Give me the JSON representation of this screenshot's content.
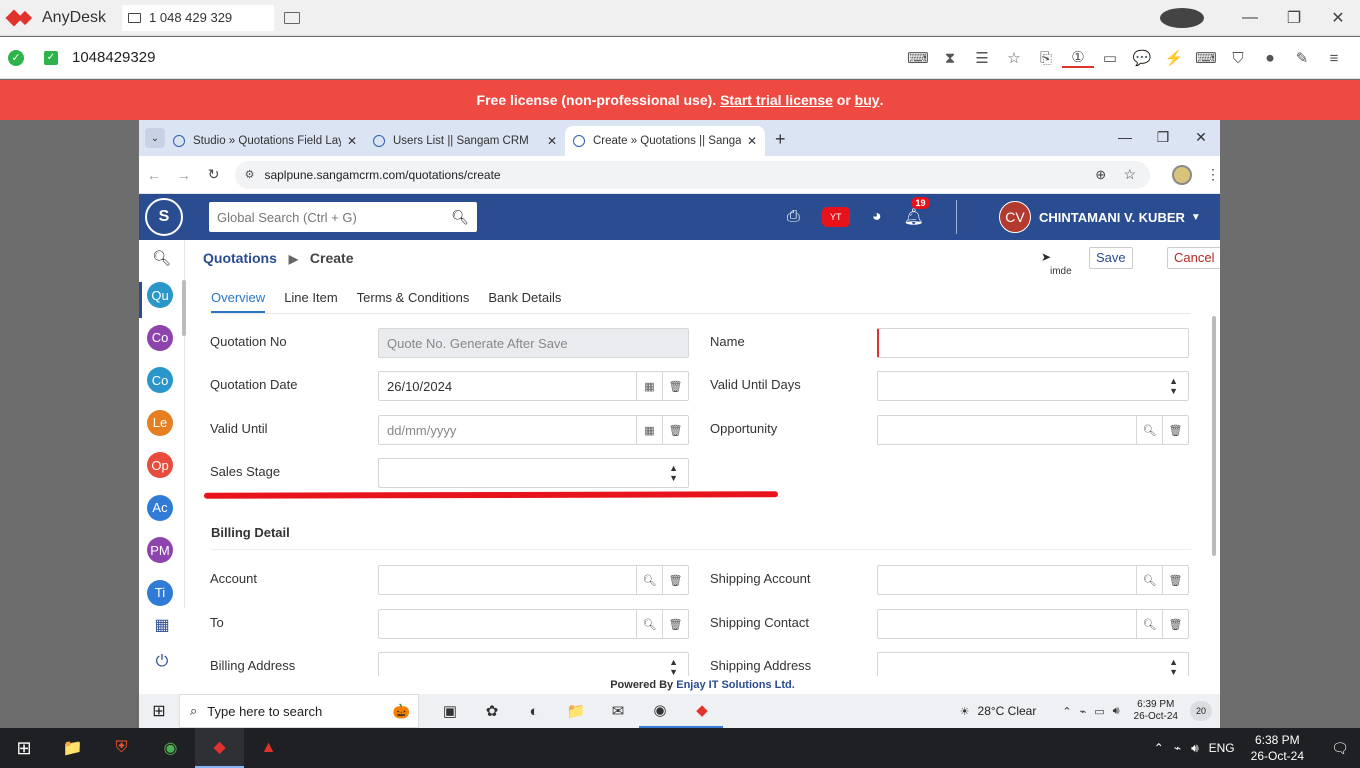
{
  "anydesk": {
    "app_name": "AnyDesk",
    "tab_label": "1 048 429 329",
    "address_id": "1048429329",
    "banner": {
      "text_pre": "Free license (non-professional use).",
      "trial_link": "Start trial license",
      "or": "or",
      "buy_link": "buy",
      "period": "."
    }
  },
  "browser": {
    "tabs": [
      {
        "title": "Studio » Quotations Field Layou"
      },
      {
        "title": "Users List || Sangam CRM"
      },
      {
        "title": "Create » Quotations || Sangam"
      }
    ],
    "url": "saplpune.sangamcrm.com/quotations/create"
  },
  "crm": {
    "logo_text": "S",
    "search_placeholder": "Global Search (Ctrl + G)",
    "notifications_count": "19",
    "youtube_icon": "YT",
    "user_initials": "CV",
    "user_name": "CHINTAMANI V. KUBER",
    "sidebar": [
      {
        "label": "Qu",
        "color": "#2a96c9"
      },
      {
        "label": "Co",
        "color": "#8e44ad"
      },
      {
        "label": "Co",
        "color": "#2a96c9"
      },
      {
        "label": "Le",
        "color": "#e67e22"
      },
      {
        "label": "Op",
        "color": "#e74c3c"
      },
      {
        "label": "Ac",
        "color": "#2f7bd6"
      },
      {
        "label": "PM",
        "color": "#8e44ad"
      },
      {
        "label": "Ti",
        "color": "#2f7bd6"
      }
    ],
    "breadcrumb": {
      "module": "Quotations",
      "action": "Create"
    },
    "buttons": {
      "save": "Save",
      "cancel": "Cancel"
    },
    "cursor_tooltip": "imde",
    "tabs": [
      "Overview",
      "Line Item",
      "Terms & Conditions",
      "Bank Details"
    ],
    "fields": {
      "quotation_no_label": "Quotation No",
      "quotation_no_placeholder": "Quote No. Generate After Save",
      "name_label": "Name",
      "quotation_date_label": "Quotation Date",
      "quotation_date_value": "26/10/2024",
      "valid_until_days_label": "Valid Until Days",
      "valid_until_label": "Valid Until",
      "valid_until_placeholder": "dd/mm/yyyy",
      "opportunity_label": "Opportunity",
      "sales_stage_label": "Sales Stage"
    },
    "billing": {
      "section_title": "Billing Detail",
      "account_label": "Account",
      "shipping_account_label": "Shipping Account",
      "to_label": "To",
      "shipping_contact_label": "Shipping Contact",
      "billing_address_label": "Billing Address",
      "shipping_address_label": "Shipping Address"
    },
    "footer": {
      "pre": "Powered By",
      "company": "Enjay IT Solutions Ltd."
    }
  },
  "remote_taskbar": {
    "search_placeholder": "Type here to search",
    "weather": "28°C  Clear",
    "time": "6:39 PM",
    "date": "26-Oct-24",
    "notif_count": "20"
  },
  "local_taskbar": {
    "lang": "ENG",
    "time": "6:38 PM",
    "date": "26-Oct-24"
  },
  "colors": {
    "header": "#2a4c91",
    "banner": "#ef4a42",
    "accent_tab": "#2a76c4",
    "annotation": "#e8141c"
  }
}
